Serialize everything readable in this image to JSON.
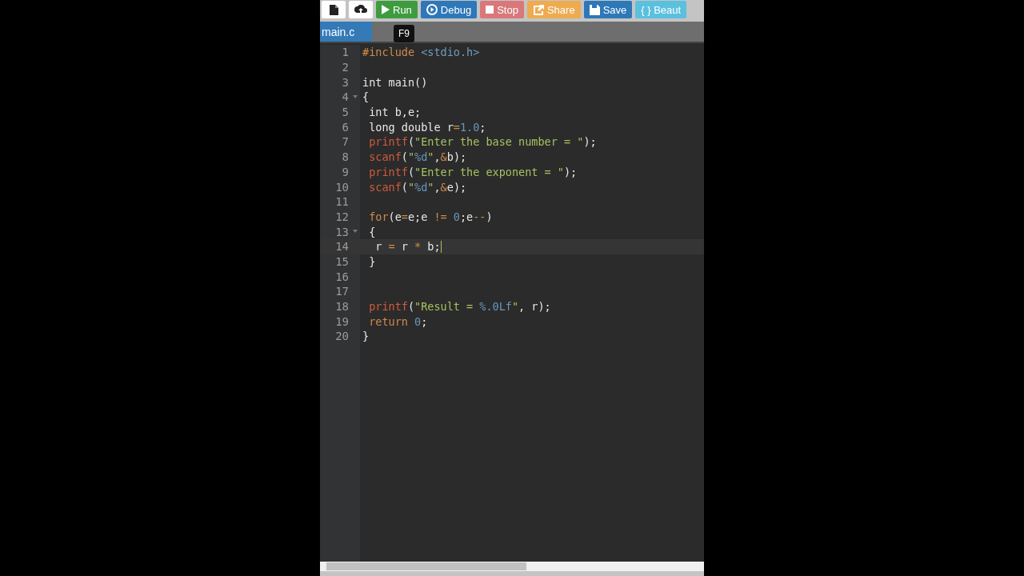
{
  "toolbar": {
    "buttons": [
      {
        "kind": "new-file"
      },
      {
        "kind": "upload"
      },
      {
        "kind": "run",
        "label": "Run"
      },
      {
        "kind": "debug",
        "label": "Debug"
      },
      {
        "kind": "stop",
        "label": "Stop"
      },
      {
        "kind": "share",
        "label": "Share"
      },
      {
        "kind": "save",
        "label": "Save"
      },
      {
        "kind": "beautify",
        "label": "{ } Beaut"
      }
    ],
    "tooltip": "F9"
  },
  "tabs": [
    {
      "label": "main.c",
      "selected": true
    }
  ],
  "editor": {
    "lines": [
      {
        "number": "1",
        "tokens": [
          {
            "kind": "keyword",
            "text": "#include"
          },
          {
            "kind": "header",
            "text": " <stdio.h>"
          }
        ]
      },
      {
        "number": "2"
      },
      {
        "number": "3",
        "tokens": [
          {
            "kind": "plain",
            "text": "int main()"
          }
        ]
      },
      {
        "number": "4",
        "fold": true,
        "tokens": [
          {
            "kind": "plain",
            "text": "{"
          }
        ]
      },
      {
        "number": "5",
        "tokens": [
          {
            "kind": "plain",
            "text": " int b,e;"
          }
        ]
      },
      {
        "number": "6",
        "tokens": [
          {
            "kind": "plain",
            "text": " long double r"
          },
          {
            "kind": "operator",
            "text": "="
          },
          {
            "kind": "number",
            "text": "1.0"
          },
          {
            "kind": "plain",
            "text": ";"
          }
        ]
      },
      {
        "number": "7",
        "tokens": [
          {
            "kind": "function",
            "text": " printf"
          },
          {
            "kind": "plain",
            "text": "("
          },
          {
            "kind": "string",
            "text": "\"Enter the base number = \""
          },
          {
            "kind": "plain",
            "text": ");"
          }
        ]
      },
      {
        "number": "8",
        "tokens": [
          {
            "kind": "function",
            "text": " scanf"
          },
          {
            "kind": "plain",
            "text": "("
          },
          {
            "kind": "string",
            "text": "\""
          },
          {
            "kind": "number",
            "text": "%d"
          },
          {
            "kind": "string",
            "text": "\""
          },
          {
            "kind": "plain",
            "text": ","
          },
          {
            "kind": "operator",
            "text": "&"
          },
          {
            "kind": "plain",
            "text": "b);"
          }
        ]
      },
      {
        "number": "9",
        "tokens": [
          {
            "kind": "function",
            "text": " printf"
          },
          {
            "kind": "plain",
            "text": "("
          },
          {
            "kind": "string",
            "text": "\"Enter the exponent = \""
          },
          {
            "kind": "plain",
            "text": ");"
          }
        ]
      },
      {
        "number": "10",
        "tokens": [
          {
            "kind": "function",
            "text": " scanf"
          },
          {
            "kind": "plain",
            "text": "("
          },
          {
            "kind": "string",
            "text": "\""
          },
          {
            "kind": "number",
            "text": "%d"
          },
          {
            "kind": "string",
            "text": "\""
          },
          {
            "kind": "plain",
            "text": ","
          },
          {
            "kind": "operator",
            "text": "&"
          },
          {
            "kind": "plain",
            "text": "e);"
          }
        ]
      },
      {
        "number": "11"
      },
      {
        "number": "12",
        "tokens": [
          {
            "kind": "keyword",
            "text": " for"
          },
          {
            "kind": "plain",
            "text": "(e"
          },
          {
            "kind": "operator",
            "text": "="
          },
          {
            "kind": "plain",
            "text": "e;e "
          },
          {
            "kind": "operator",
            "text": "!="
          },
          {
            "kind": "number",
            "text": " 0"
          },
          {
            "kind": "plain",
            "text": ";e"
          },
          {
            "kind": "operator",
            "text": "--"
          },
          {
            "kind": "plain",
            "text": ")"
          }
        ]
      },
      {
        "number": "13",
        "fold": true,
        "tokens": [
          {
            "kind": "plain",
            "text": " {"
          }
        ]
      },
      {
        "number": "14",
        "active": true,
        "tokens": [
          {
            "kind": "plain",
            "text": "  r "
          },
          {
            "kind": "operator",
            "text": "="
          },
          {
            "kind": "plain",
            "text": " r "
          },
          {
            "kind": "operator",
            "text": "*"
          },
          {
            "kind": "plain",
            "text": " b;"
          }
        ]
      },
      {
        "number": "15",
        "tokens": [
          {
            "kind": "plain",
            "text": " }"
          }
        ]
      },
      {
        "number": "16"
      },
      {
        "number": "17"
      },
      {
        "number": "18",
        "tokens": [
          {
            "kind": "function",
            "text": " printf"
          },
          {
            "kind": "plain",
            "text": "("
          },
          {
            "kind": "string",
            "text": "\"Result = "
          },
          {
            "kind": "number",
            "text": "%.0Lf"
          },
          {
            "kind": "string",
            "text": "\""
          },
          {
            "kind": "plain",
            "text": ", r);"
          }
        ]
      },
      {
        "number": "19",
        "tokens": [
          {
            "kind": "keyword",
            "text": " return"
          },
          {
            "kind": "number",
            "text": " 0"
          },
          {
            "kind": "plain",
            "text": ";"
          }
        ]
      },
      {
        "number": "20",
        "tokens": [
          {
            "kind": "plain",
            "text": "}"
          }
        ]
      }
    ]
  }
}
